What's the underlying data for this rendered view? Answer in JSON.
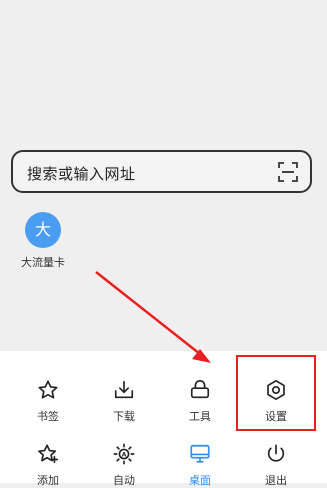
{
  "search": {
    "placeholder_text": "搜索或输入网址",
    "scan_icon": "scan-icon"
  },
  "shortcuts": [
    {
      "letter": "大",
      "label": "大流量卡",
      "color": "#4a9df0"
    }
  ],
  "menu": {
    "row1": [
      {
        "label": "书签",
        "icon": "star-icon"
      },
      {
        "label": "下载",
        "icon": "download-icon"
      },
      {
        "label": "工具",
        "icon": "toolbox-icon"
      },
      {
        "label": "设置",
        "icon": "hexagon-settings-icon"
      }
    ],
    "row2": [
      {
        "label": "添加",
        "icon": "star-plus-icon"
      },
      {
        "label": "自动",
        "icon": "auto-brightness-icon"
      },
      {
        "label": "桌面",
        "icon": "desktop-icon",
        "active": true
      },
      {
        "label": "退出",
        "icon": "power-icon"
      }
    ]
  },
  "colors": {
    "accent": "#2d8cf0",
    "highlight": "#e8201f",
    "shortcut_bg": "#4a9df0"
  }
}
